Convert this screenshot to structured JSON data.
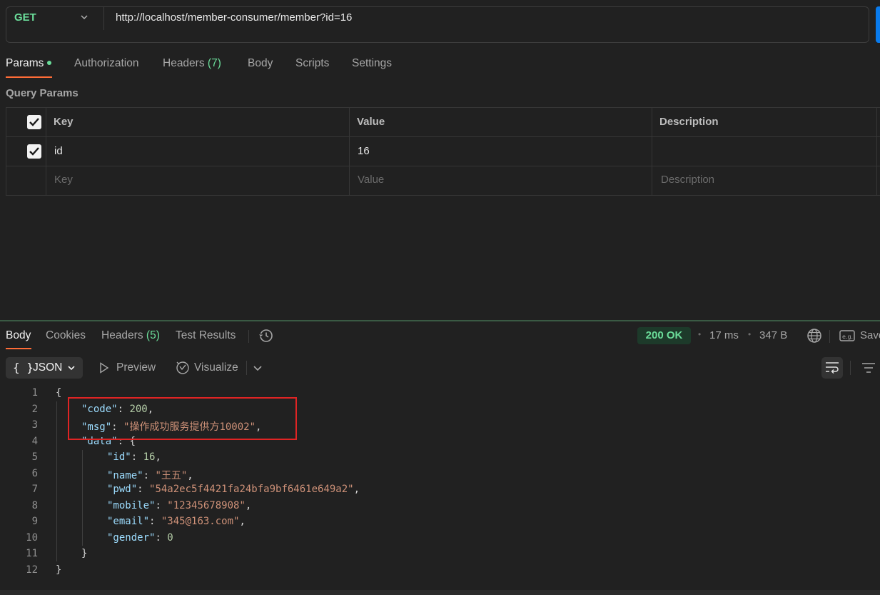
{
  "request": {
    "method": "GET",
    "url": "http://localhost/member-consumer/member?id=16"
  },
  "request_tabs": {
    "params": "Params",
    "authorization": "Authorization",
    "headers": "Headers",
    "headers_count": "(7)",
    "body": "Body",
    "scripts": "Scripts",
    "settings": "Settings"
  },
  "query_params": {
    "title": "Query Params",
    "columns": {
      "key": "Key",
      "value": "Value",
      "description": "Description"
    },
    "rows": [
      {
        "checked": true,
        "key": "id",
        "value": "16",
        "description": ""
      }
    ],
    "placeholder": {
      "key": "Key",
      "value": "Value",
      "description": "Description"
    }
  },
  "response_tabs": {
    "body": "Body",
    "cookies": "Cookies",
    "headers": "Headers",
    "headers_count": "(5)",
    "test_results": "Test Results"
  },
  "response_meta": {
    "status": "200 OK",
    "time": "17 ms",
    "size": "347 B",
    "save": "Save"
  },
  "format_toolbar": {
    "format": "JSON",
    "format_icon": "{ }",
    "preview": "Preview",
    "visualize": "Visualize"
  },
  "code": {
    "line_numbers": [
      "1",
      "2",
      "3",
      "4",
      "5",
      "6",
      "7",
      "8",
      "9",
      "10",
      "11",
      "12"
    ],
    "open_brace": "{",
    "close_brace": "}",
    "code_key": "\"code\"",
    "code_val": "200",
    "msg_key": "\"msg\"",
    "msg_val": "\"操作成功服务提供方10002\"",
    "data_key": "\"data\"",
    "data_open": "{",
    "data_close": "}",
    "fields": [
      {
        "key": "\"id\"",
        "value": "16",
        "type": "number",
        "comma": ","
      },
      {
        "key": "\"name\"",
        "value": "\"王五\"",
        "type": "string",
        "comma": ","
      },
      {
        "key": "\"pwd\"",
        "value": "\"54a2ec5f4421fa24bfa9bf6461e649a2\"",
        "type": "string",
        "comma": ","
      },
      {
        "key": "\"mobile\"",
        "value": "\"12345678908\"",
        "type": "string",
        "comma": ","
      },
      {
        "key": "\"email\"",
        "value": "\"345@163.com\"",
        "type": "string",
        "comma": ","
      },
      {
        "key": "\"gender\"",
        "value": "0",
        "type": "number",
        "comma": ""
      }
    ]
  },
  "colors": {
    "accent_green": "#6bdd9a",
    "tab_underline": "#ff6c37",
    "highlight_box": "#e02424",
    "json_key": "#9cdcfe",
    "json_string": "#ce9178",
    "json_number": "#b5cea8"
  }
}
